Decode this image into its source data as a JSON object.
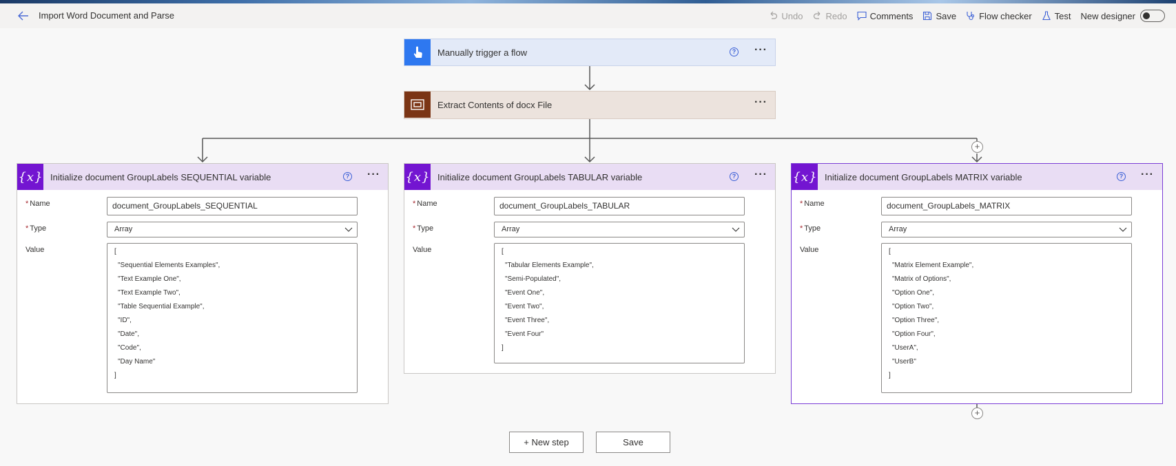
{
  "header": {
    "title": "Import Word Document and Parse",
    "undo": "Undo",
    "redo": "Redo",
    "comments": "Comments",
    "save": "Save",
    "flow_checker": "Flow checker",
    "test": "Test",
    "new_designer": "New designer"
  },
  "trigger": {
    "title": "Manually trigger a flow"
  },
  "extract": {
    "title": "Extract Contents of docx File"
  },
  "fields": {
    "name": "Name",
    "type": "Type",
    "value": "Value",
    "required": "*"
  },
  "branches": [
    {
      "title": "Initialize document GroupLabels SEQUENTIAL variable",
      "name": "document_GroupLabels_SEQUENTIAL",
      "type": "Array",
      "value_lines": [
        "[",
        "\"Sequential Elements Examples\",",
        "\"Text Example One\",",
        "\"Text Example Two\",",
        "\"Table Sequential Example\",",
        "\"ID\",",
        "\"Date\",",
        "\"Code\",",
        "\"Day Name\"",
        "]"
      ]
    },
    {
      "title": "Initialize document GroupLabels TABULAR variable",
      "name": "document_GroupLabels_TABULAR",
      "type": "Array",
      "value_lines": [
        "[",
        "\"Tabular Elements Example\",",
        "\"Semi-Populated\",",
        "\"Event One\",",
        "\"Event Two\",",
        "\"Event Three\",",
        "\"Event Four\"",
        "]"
      ]
    },
    {
      "title": "Initialize document GroupLabels MATRIX variable",
      "name": "document_GroupLabels_MATRIX",
      "type": "Array",
      "value_lines": [
        "[",
        "\"Matrix Element Example\",",
        "\"Matrix of Options\",",
        "\"Option One\",",
        "\"Option Two\",",
        "\"Option Three\",",
        "\"Option Four\",",
        "\"UserA\",",
        "\"UserB\"",
        "]"
      ]
    }
  ],
  "footer": {
    "new_step": "+ New step",
    "save": "Save"
  },
  "icons": {
    "back": "back-arrow-icon",
    "trigger": "touch-hand-icon",
    "extract": "document-frame-icon",
    "variable": "variable-icon",
    "help": "help-icon",
    "more": "more-options-icon",
    "add": "add-icon",
    "chevron": "chevron-down-icon"
  },
  "colors": {
    "trigger": "#2e78f0",
    "extract": "#7b3515",
    "variable": "#7315d1",
    "accent": "#3a5fd6"
  }
}
